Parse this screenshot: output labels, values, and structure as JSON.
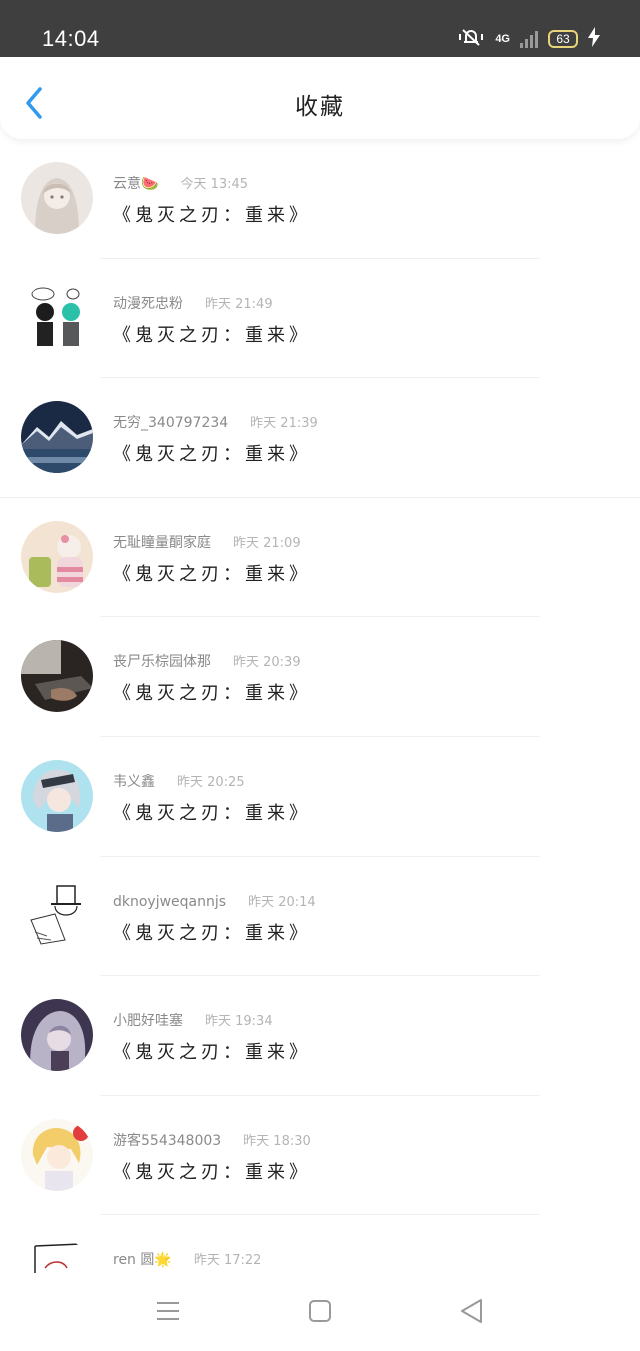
{
  "status_bar": {
    "time": "14:04",
    "network": "4G",
    "battery": "63"
  },
  "header": {
    "title": "收藏"
  },
  "colors": {
    "accent": "#2f9af0",
    "background": "#ffffff",
    "status_bar": "#3f3f3f"
  },
  "items": [
    {
      "name": "云意🍉",
      "time": "今天 13:45",
      "content": "《鬼灭之刃：重来》",
      "avatar": "anime-girl-avatar"
    },
    {
      "name": "动漫死忠粉",
      "time": "昨天 21:49",
      "content": "《鬼灭之刃：重来》",
      "avatar": "anime-duo-avatar"
    },
    {
      "name": "无穷_340797234",
      "time": "昨天 21:39",
      "content": "《鬼灭之刃：重来》",
      "avatar": "mountain-lake-avatar"
    },
    {
      "name": "无耻瞳量酮家庭",
      "time": "昨天 21:09",
      "content": "《鬼灭之刃：重来》",
      "avatar": "plush-bear-drink-avatar"
    },
    {
      "name": "丧尸乐棕园体那",
      "time": "昨天 20:39",
      "content": "《鬼灭之刃：重来》",
      "avatar": "laptop-hand-avatar"
    },
    {
      "name": "韦义鑫",
      "time": "昨天 20:25",
      "content": "《鬼灭之刃：重来》",
      "avatar": "silver-hair-character-avatar"
    },
    {
      "name": "dknoyjweqannjs",
      "time": "昨天 20:14",
      "content": "《鬼灭之刃：重来》",
      "avatar": "top-hat-sketch-avatar"
    },
    {
      "name": "小肥好哇塞",
      "time": "昨天 19:34",
      "content": "《鬼灭之刃：重来》",
      "avatar": "purple-hair-girl-avatar"
    },
    {
      "name": "游客554348003",
      "time": "昨天 18:30",
      "content": "《鬼灭之刃：重来》",
      "avatar": "blonde-girl-avatar"
    },
    {
      "name": "ren 圆🌟",
      "time": "昨天 17:22",
      "content": "",
      "avatar": "sketch-avatar"
    }
  ]
}
